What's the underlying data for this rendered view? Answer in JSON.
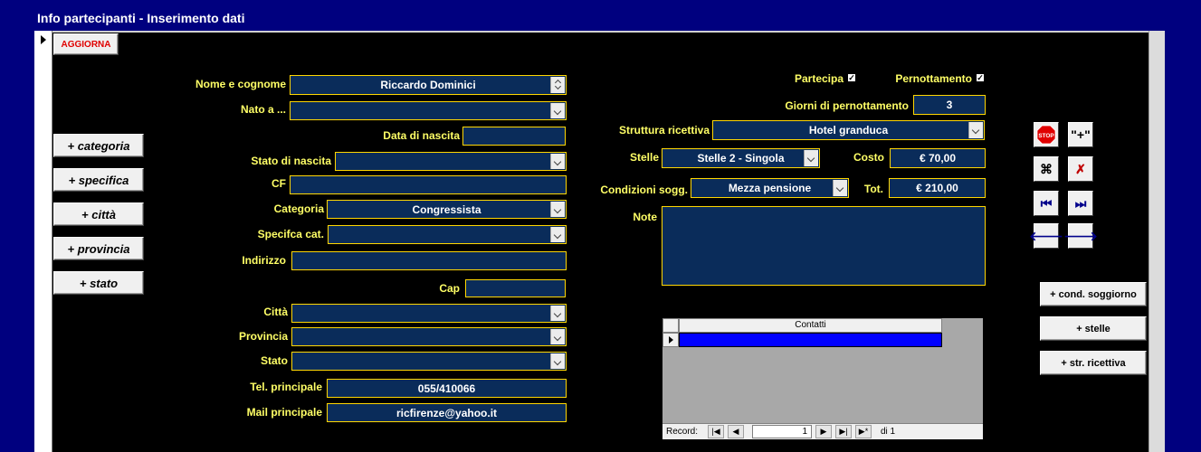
{
  "window": {
    "title": "Info partecipanti - Inserimento dati"
  },
  "toolbar": {
    "aggiorna_label": "AGGIORNA"
  },
  "add_buttons": {
    "categoria": "+ categoria",
    "specifica": "+ specifica",
    "citta": "+  città",
    "provincia": "+ provincia",
    "stato": "+ stato"
  },
  "form": {
    "nome_label": "Nome e cognome",
    "nome_value": "Riccardo Dominici",
    "nato_label": "Nato a ...",
    "nato_value": "",
    "data_nascita_label": "Data di nascita",
    "data_nascita_value": "",
    "stato_nascita_label": "Stato di nascita",
    "stato_nascita_value": "",
    "cf_label": "CF",
    "cf_value": "",
    "categoria_label": "Categoria",
    "categoria_value": "Congressista",
    "specifica_label": "Specifca cat.",
    "specifica_value": "",
    "indirizzo_label": "Indirizzo",
    "indirizzo_value": "",
    "cap_label": "Cap",
    "cap_value": "",
    "citta_label": "Città",
    "citta_value": "",
    "provincia_label": "Provincia",
    "provincia_value": "",
    "stato_label": "Stato",
    "stato_value": "",
    "tel_label": "Tel. principale",
    "tel_value": "055/410066",
    "mail_label": "Mail principale",
    "mail_value": "ricfirenze@yahoo.it"
  },
  "stay": {
    "partecipa_label": "Partecipa",
    "partecipa_checked": true,
    "pernottamento_label": "Pernottamento",
    "pernottamento_checked": true,
    "giorni_label": "Giorni di pernottamento",
    "giorni_value": "3",
    "struttura_label": "Struttura ricettiva",
    "struttura_value": "Hotel granduca",
    "stelle_label": "Stelle",
    "stelle_value": "Stelle 2 - Singola",
    "costo_label": "Costo",
    "costo_value": "€ 70,00",
    "condizioni_label": "Condizioni sogg.",
    "condizioni_value": "Mezza pensione",
    "tot_label": "Tot.",
    "tot_value": "€ 210,00",
    "note_label": "Note",
    "note_value": ""
  },
  "side_buttons": {
    "stop_icon": "stop-icon",
    "new_label": "\"+\"",
    "find_icon": "binoculars-icon",
    "delete_icon": "delete-record-icon",
    "first_icon": "first-record-icon",
    "last_icon": "last-record-icon",
    "prev_icon": "prev-arrow-icon",
    "next_icon": "next-arrow-icon",
    "cond_soggiorno": "+ cond. soggiorno",
    "stelle": "+ stelle",
    "str_ricettiva": "+ str. ricettiva"
  },
  "subform": {
    "column_header": "Contatti",
    "record_label": "Record:",
    "current_record": "1",
    "of_label": "di 1"
  },
  "colors": {
    "frame": "#00007f",
    "field_bg": "#0a2c5a",
    "label": "#ffff66",
    "field_border": "#ffd700"
  }
}
